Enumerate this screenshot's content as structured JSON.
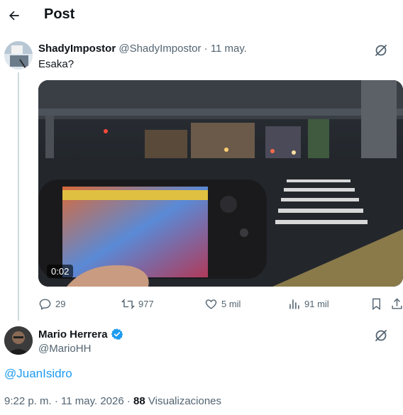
{
  "header": {
    "title": "Post"
  },
  "quoted_tweet": {
    "display_name": "ShadyImpostor",
    "handle": "@ShadyImpostor",
    "date": "· 11 may.",
    "text": "Esaka?",
    "video": {
      "duration": "0:02"
    },
    "actions": {
      "replies": "29",
      "reposts": "977",
      "likes": "5 mil",
      "views": "91 mil"
    }
  },
  "main_tweet": {
    "display_name": "Mario Herrera",
    "handle": "@MarioHH",
    "verified": true,
    "text": "@JuanIsidro",
    "time": "9:22 p. m. · 11 may. 2026 ·",
    "views_count": "88",
    "views_label": "Visualizaciones"
  },
  "colors": {
    "text": "#0f1419",
    "muted": "#536471",
    "link": "#1d9bf0",
    "verified": "#1d9bf0",
    "thread_line": "#cfd9de"
  },
  "icons": {
    "back": "arrow-left-icon",
    "grok": "grok-icon",
    "reply": "reply-icon",
    "repost": "repost-icon",
    "like": "heart-icon",
    "views": "views-icon",
    "bookmark": "bookmark-icon",
    "share": "share-icon",
    "verified": "verified-badge-icon"
  }
}
